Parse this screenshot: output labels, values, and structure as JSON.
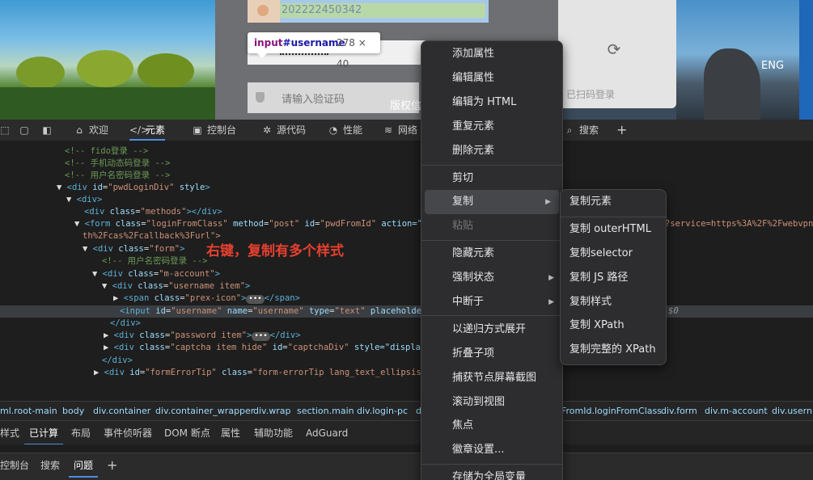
{
  "page_preview": {
    "username_value": "202222450342",
    "tooltip": {
      "tag": "input",
      "id": "#username",
      "size": "278 × 40"
    },
    "captcha_placeholder": "请输入验证码",
    "copyright": "版权信",
    "qr_hint": "已扫码登录",
    "lang_button": "ENG"
  },
  "toolbar": {
    "tabs": [
      {
        "label": "欢迎",
        "icon": "home-icon"
      },
      {
        "label": "元素",
        "icon": "code-icon"
      },
      {
        "label": "控制台",
        "icon": "console-icon"
      },
      {
        "label": "源代码",
        "icon": "bug-icon"
      },
      {
        "label": "性能",
        "icon": "gauge-icon"
      },
      {
        "label": "网络",
        "icon": "wifi-icon"
      },
      {
        "label": "搜索",
        "icon": "search-icon"
      }
    ],
    "add_label": "+"
  },
  "dom_tree": {
    "lines": [
      {
        "t": "<!-- fido登录 -->"
      },
      {
        "t": "<!-- 手机动态码登录 -->"
      },
      {
        "t": "<!-- 用户名密码登录 -->"
      }
    ],
    "pwd_div": {
      "id_attr": "id",
      "id_val": "\"pwdLoginDiv\"",
      "style": "style"
    },
    "methods": {
      "class_val": "\"methods\""
    },
    "form": {
      "class_val": "\"loginFromClass\"",
      "method_val": "\"post\"",
      "id_val": "\"pwdFromId\"",
      "action_prefix": "action=\"ht",
      "action_tail": "?service=https%3A%2F%2Fwebvpn",
      "action_wrap": "th%2Fcas%2Fcallback%3Furl\">"
    },
    "div_form_class": "\"form\"",
    "comment_pwd": "<!-- 用户名密码登录 -->",
    "m_account_class": "\"m-account\"",
    "username_item_class": "\"username item\"",
    "prex_icon_class": "\"prex-icon\"",
    "input_line": {
      "id_val": "\"username\"",
      "name_val": "\"username\"",
      "type_val": "\"text\"",
      "placeholder": "placeholder=",
      "tail": "$0"
    },
    "password_item_class": "\"password item\"",
    "captcha_class": "\"captcha item hide\"",
    "captcha_id": "\"captchaDiv\"",
    "captcha_style": "style=\"display:",
    "error_tip_id": "\"formErrorTip\"",
    "error_tip_class": "\"form-errorTip lang_text_ellipsis\"",
    "annotation": "右键，复制有多个样式"
  },
  "breadcrumbs": [
    "ml.root-main",
    "body",
    "div.container",
    "div.container_wrapper",
    "div.wrap",
    "section.main",
    "div.login-pc",
    "d",
    "FromId.loginFromClass",
    "div.form",
    "div.m-account",
    "div.usern"
  ],
  "styles_tabs": [
    "样式",
    "已计算",
    "布局",
    "事件侦听器",
    "DOM 断点",
    "属性",
    "辅助功能",
    "AdGuard"
  ],
  "drawer_tabs": [
    "控制台",
    "搜索",
    "问题"
  ],
  "context_menu": {
    "items": [
      "添加属性",
      "编辑属性",
      "编辑为 HTML",
      "重复元素",
      "删除元素",
      "剪切",
      "复制",
      "粘贴",
      "隐藏元素",
      "强制状态",
      "中断于",
      "以递归方式展开",
      "折叠子项",
      "捕获节点屏幕截图",
      "滚动到视图",
      "焦点",
      "徽章设置...",
      "存储为全局变量"
    ]
  },
  "copy_submenu": {
    "items": [
      "复制元素",
      "复制 outerHTML",
      "复制selector",
      "复制 JS 路径",
      "复制样式",
      "复制 XPath",
      "复制完整的 XPath"
    ]
  }
}
